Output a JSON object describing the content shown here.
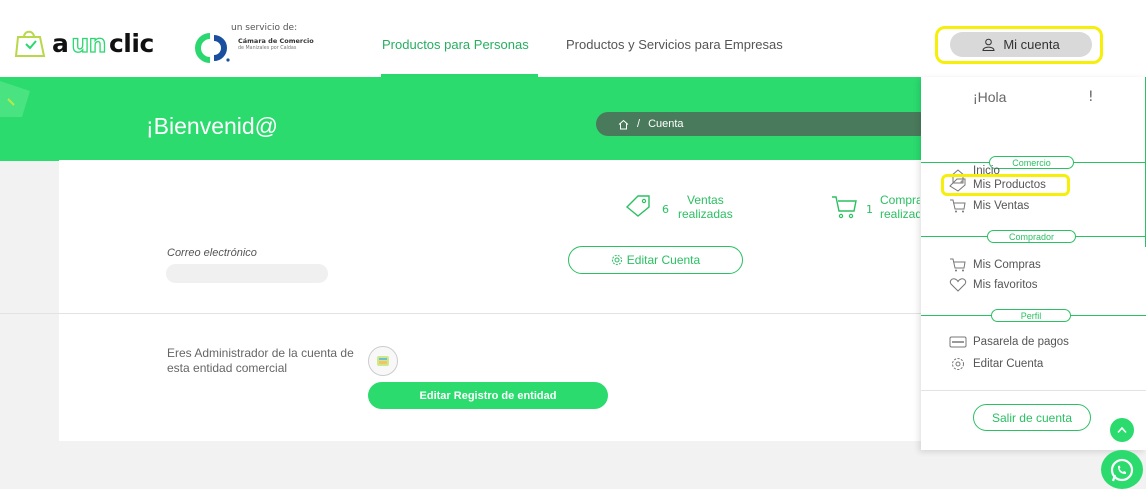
{
  "header": {
    "logo_text_a": "a",
    "logo_text_un": "un",
    "logo_text_clic": "clic",
    "cam_small": "un servicio de:",
    "cam_name": "Cámara de Comercio",
    "cam_sub": "de Manizales por Caldas",
    "nav": [
      {
        "label": "Productos para Personas",
        "active": true
      },
      {
        "label": "Productos y Servicios para Empresas",
        "active": false
      }
    ],
    "account_label": "Mi cuenta"
  },
  "banner": {
    "welcome": "¡Bienvenid@",
    "breadcrumb_current": "Cuenta",
    "breadcrumb_sep": "/"
  },
  "stats": {
    "ventas_count": "6",
    "ventas_label_1": "Ventas",
    "ventas_label_2": "realizadas",
    "compras_count": "1",
    "compras_label_1": "Compras",
    "compras_label_2": "realizadas"
  },
  "profile": {
    "email_label": "Correo electrónico",
    "edit_account": "Editar Cuenta",
    "admin_text": "Eres Administrador de la cuenta de esta entidad comercial",
    "edit_entity": "Editar Registro de entidad"
  },
  "dropdown": {
    "greeting": "¡Hola",
    "greeting_end": "!",
    "sections": [
      {
        "label": "Comercio",
        "items": [
          "Inicio",
          "Mis Productos",
          "Mis Ventas"
        ]
      },
      {
        "label": "Comprador",
        "items": [
          "Mis Compras",
          "Mis favoritos"
        ]
      },
      {
        "label": "Perfil",
        "items": [
          "Pasarela de pagos",
          "Editar Cuenta"
        ]
      }
    ],
    "logout": "Salir de cuenta"
  },
  "colors": {
    "brand_green": "#2bdb6e",
    "text_green": "#2bc062",
    "highlight_yellow": "#f5ef0a"
  }
}
